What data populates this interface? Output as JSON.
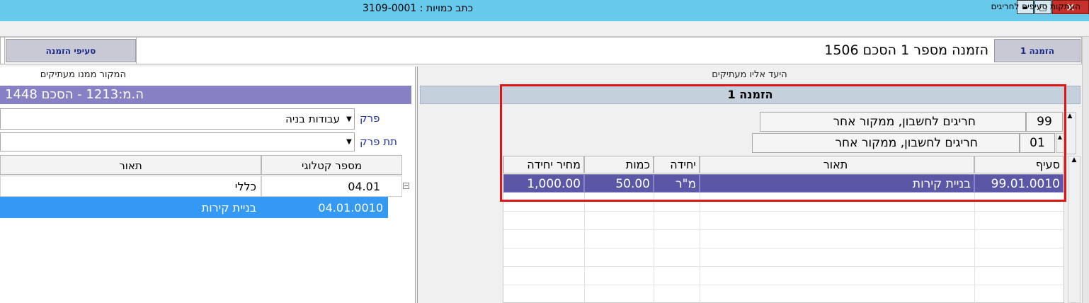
{
  "window": {
    "title": "כתב כמויות : 3109-0001",
    "close_glyph": "✕",
    "max_glyph": "□",
    "min_glyph": "▬"
  },
  "menu": {
    "item": "העתקות סעיפים לחריגים"
  },
  "toolbar": {
    "order_tab": "הזמנה 1",
    "order_title": "הזמנה מספר 1 הסכם 1506",
    "order_items_button": "סעיפי הזמנה"
  },
  "source": {
    "caption": "המקור ממנו מעתיקים",
    "header": "ה.מ:1213 - הסכם 1448",
    "perek_label": "פרק",
    "perek_value": "עבודות בניה",
    "tatperek_label": "תת פרק",
    "tatperek_value": "",
    "columns": {
      "catalog": "מספר קטלוגי",
      "desc": "תאור"
    },
    "rows": [
      {
        "catalog": "04.01",
        "desc": "כללי"
      },
      {
        "catalog": "04.01.0010",
        "desc": "בניית קירות"
      }
    ]
  },
  "target": {
    "caption": "היעד אליו מעתיקים",
    "header": "הזמנה 1",
    "group1": {
      "code": "99",
      "name": "חריגים לחשבון, ממקור אחר"
    },
    "group2": {
      "code": "01",
      "name": "חריגים לחשבון, ממקור אחר"
    },
    "columns": {
      "section": "סעיף",
      "desc": "תאור",
      "unit": "יחידה",
      "qty": "כמות",
      "price": "מחיר יחידה"
    },
    "rows": [
      {
        "section": "99.01.0010",
        "desc": "בניית קירות",
        "unit": "מ\"ר",
        "qty": "50.00",
        "price": "1,000.00"
      }
    ]
  },
  "colors": {
    "title_bar": "#67c9ec",
    "source_header": "#8581c4",
    "selected_row": "#5b57a6",
    "highlight_box": "#e01414"
  }
}
